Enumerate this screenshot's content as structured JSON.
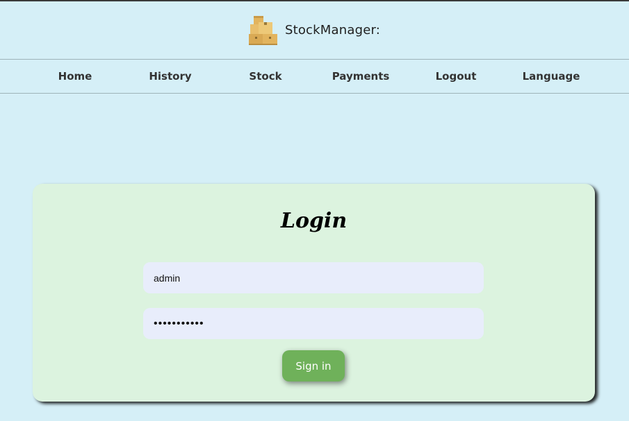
{
  "header": {
    "brand": "StockManager:",
    "logo_icon": "boxes-icon"
  },
  "nav": {
    "items": [
      {
        "label": "Home"
      },
      {
        "label": "History"
      },
      {
        "label": "Stock"
      },
      {
        "label": "Payments"
      },
      {
        "label": "Logout"
      },
      {
        "label": "Language"
      }
    ]
  },
  "login": {
    "title": "Login",
    "username_value": "admin",
    "password_value": "•••••••••••",
    "submit_label": "Sign in"
  },
  "colors": {
    "background": "#d5eff7",
    "card": "#dcf3df",
    "input": "#e8edfb",
    "button": "#6fb15a"
  }
}
